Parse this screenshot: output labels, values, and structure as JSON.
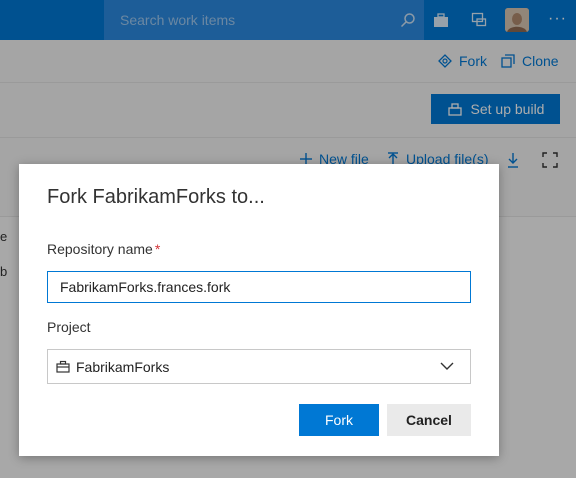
{
  "header": {
    "search_placeholder": "Search work items",
    "icons": [
      "search-icon",
      "briefcase-icon",
      "feedback-icon",
      "avatar",
      "more-icon"
    ],
    "more_label": "···"
  },
  "repo_actions": {
    "fork_label": "Fork",
    "clone_label": "Clone"
  },
  "build": {
    "setup_label": "Set up build"
  },
  "files": {
    "new_file_label": "New file",
    "upload_label": "Upload file(s)"
  },
  "left_fragments": {
    "frag1": "e",
    "frag2": "b"
  },
  "dialog": {
    "title": "Fork FabrikamForks to...",
    "repo_label": "Repository name",
    "required_mark": "*",
    "repo_value": "FabrikamForks.frances.fork",
    "project_label": "Project",
    "project_value": "FabrikamForks",
    "fork_button": "Fork",
    "cancel_button": "Cancel"
  },
  "colors": {
    "accent": "#0078d4",
    "required": "#d13438"
  }
}
